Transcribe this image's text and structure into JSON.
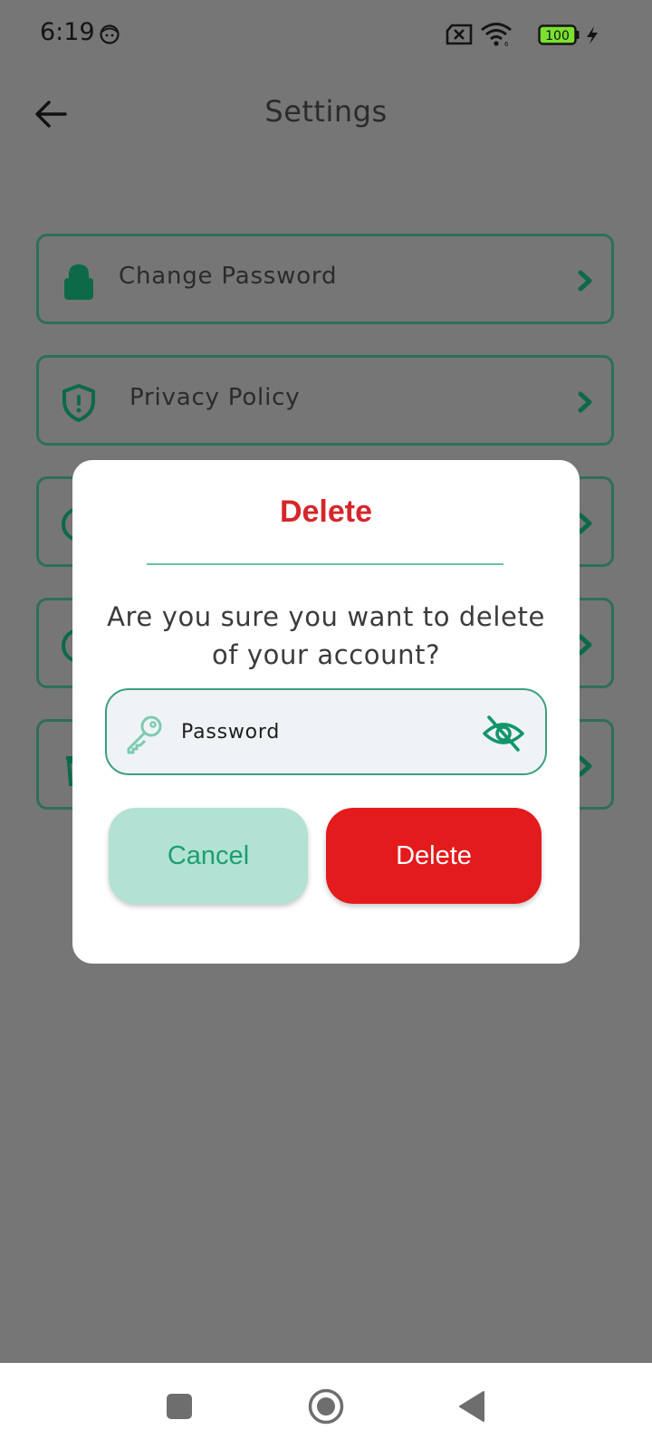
{
  "status_bar": {
    "time": "6:19",
    "battery_level": "100"
  },
  "app_bar": {
    "title": "Settings"
  },
  "settings_items": [
    {
      "label": "Change Password",
      "icon": "lock-icon"
    },
    {
      "label": "Privacy Policy",
      "icon": "shield-alert-icon"
    },
    {
      "label": "",
      "icon": "circle-icon"
    },
    {
      "label": "",
      "icon": "circle-icon"
    },
    {
      "label": "",
      "icon": "trash-icon"
    }
  ],
  "dialog": {
    "title": "Delete",
    "message": "Are you sure you want to delete of your account?",
    "password_placeholder": "Password",
    "cancel_label": "Cancel",
    "delete_label": "Delete"
  },
  "colors": {
    "accent_green": "#0f7a55",
    "delete_red": "#e31b1d",
    "title_red": "#d6262a",
    "cancel_bg": "#b1e2d3",
    "overlay": "#767676"
  }
}
